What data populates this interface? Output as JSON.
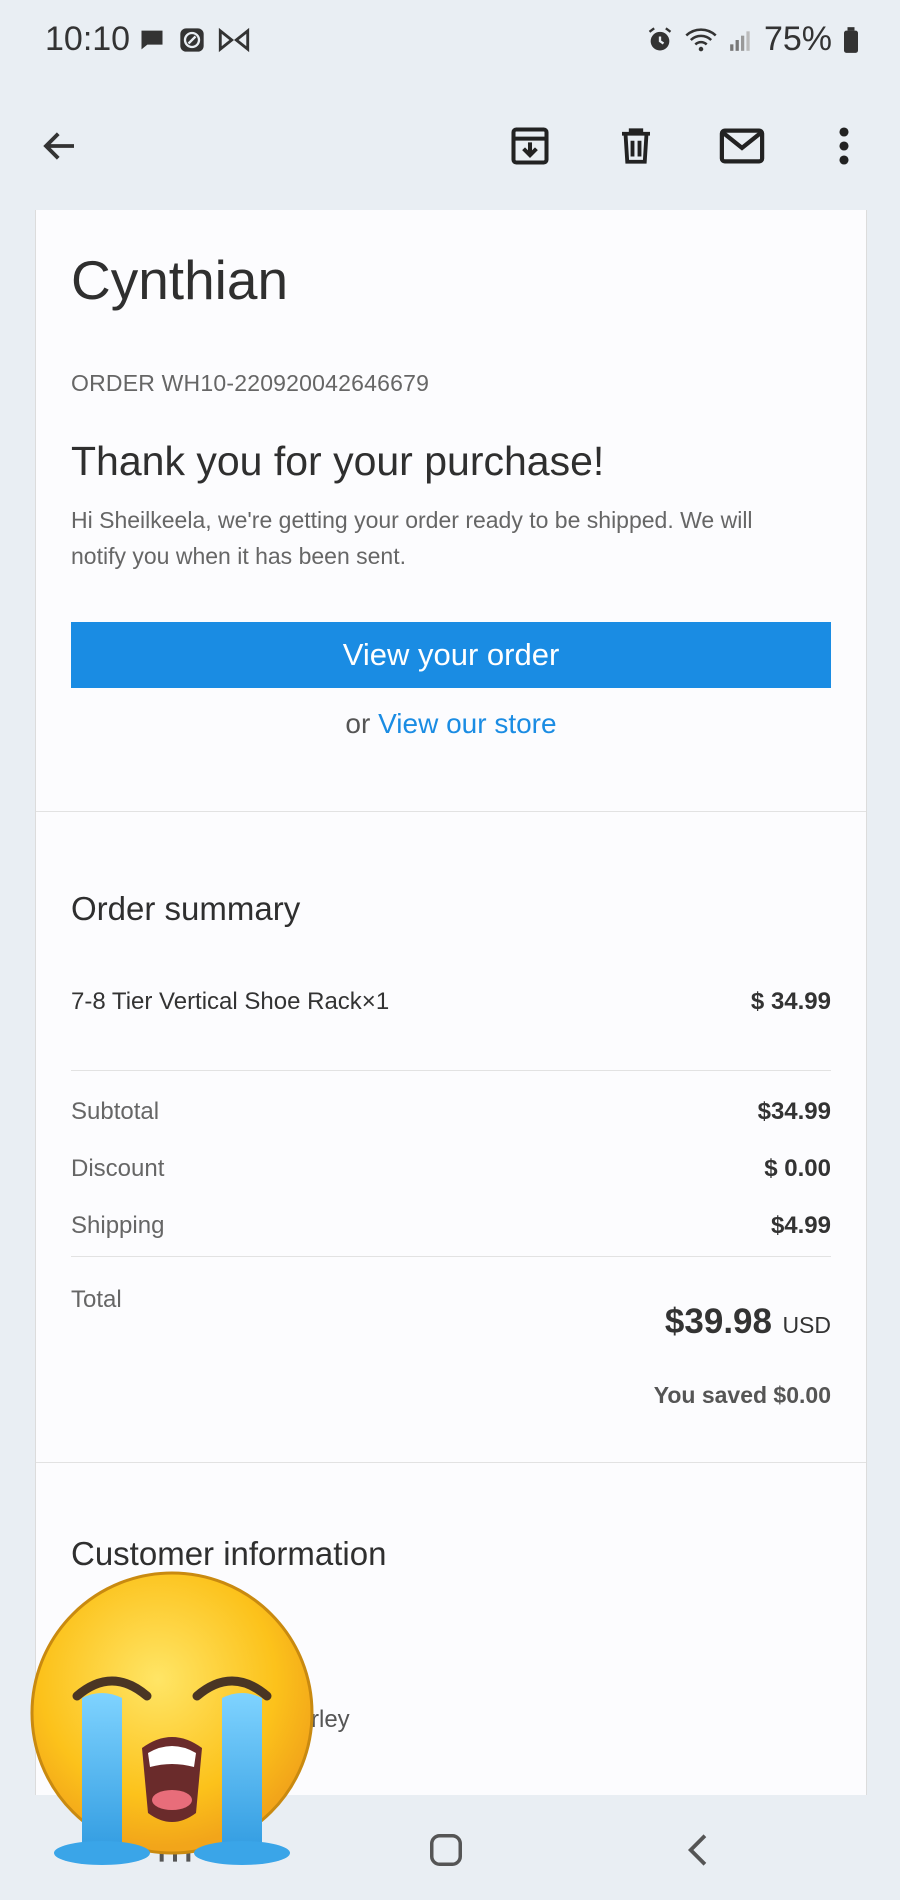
{
  "status_bar": {
    "time": "10:10",
    "battery": "75%",
    "left_icons": [
      "chat-icon",
      "messenger-icon",
      "bowtie-icon"
    ],
    "right_icons": [
      "alarm-icon",
      "wifi-icon",
      "signal-icon",
      "battery-icon"
    ]
  },
  "toolbar": {
    "icons": [
      "back-arrow-icon",
      "archive-icon",
      "delete-icon",
      "mark-unread-icon",
      "more-vert-icon"
    ]
  },
  "email": {
    "store_name": "Cynthian",
    "order_number": "ORDER WH10-220920042646679",
    "thank_title": "Thank you for your purchase!",
    "thank_message": "Hi Sheilkeela, we're getting your order ready to be shipped. We will notify you when it has been sent.",
    "view_order_label": "View your order",
    "or_text": "or",
    "view_store_label": "View our store",
    "accent_color": "#1a8ce3"
  },
  "order_summary": {
    "title": "Order summary",
    "item_name": "7-8 Tier Vertical Shoe Rack×1",
    "item_price": "$ 34.99",
    "subtotal_label": "Subtotal",
    "subtotal_value": "$34.99",
    "discount_label": "Discount",
    "discount_value": "$ 0.00",
    "shipping_label": "Shipping",
    "shipping_value": "$4.99",
    "total_label": "Total",
    "total_value": "$39.98",
    "currency": "USD",
    "saved_text": "You saved $0.00"
  },
  "customer_info": {
    "title": "Customer information",
    "partial_text": "rley"
  },
  "nav_bar": {
    "icons": [
      "recents-icon",
      "home-icon",
      "back-icon"
    ]
  }
}
